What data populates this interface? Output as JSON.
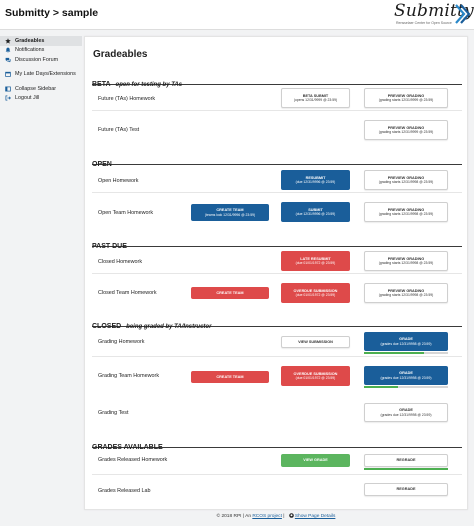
{
  "header": {
    "breadcrumb_course": "Submitty",
    "breadcrumb_sep": " > ",
    "breadcrumb_page": "sample",
    "logo_text": "Submitty",
    "logo_tagline": "Rensselaer Center for Open Source"
  },
  "sidebar": {
    "items": [
      {
        "label": "Gradeables",
        "icon": "star-icon"
      },
      {
        "label": "Notifications",
        "icon": "bell-icon"
      },
      {
        "label": "Discussion Forum",
        "icon": "comments-icon"
      },
      {
        "label": "My Late Days/Extensions",
        "icon": "calendar-icon"
      },
      {
        "label": "Collapse Sidebar",
        "icon": "collapse-icon"
      },
      {
        "label": "Logout Jill",
        "icon": "logout-icon"
      }
    ]
  },
  "main": {
    "title": "Gradeables",
    "sections": [
      {
        "key": "beta",
        "title": "BETA",
        "subtitle": "open for testing by TAs"
      },
      {
        "key": "open",
        "title": "OPEN",
        "subtitle": ""
      },
      {
        "key": "past_due",
        "title": "PAST DUE",
        "subtitle": ""
      },
      {
        "key": "closed",
        "title": "CLOSED",
        "subtitle": "being graded by TA/Instructor"
      },
      {
        "key": "grades_available",
        "title": "GRADES AVAILABLE",
        "subtitle": ""
      }
    ],
    "rows": {
      "future_tas_homework": {
        "name": "Future (TAs) Homework",
        "submit": {
          "l1": "BETA SUBMIT",
          "l2": "(opens 12/31/9999 @ 23:59)"
        },
        "grade": {
          "l1": "PREVIEW GRADING",
          "l2": "(grading starts 12/31/9999 @ 23:59)"
        }
      },
      "future_tas_test": {
        "name": "Future (TAs) Test",
        "grade": {
          "l1": "PREVIEW GRADING",
          "l2": "(grading starts 12/31/9999 @ 23:59)"
        }
      },
      "open_homework": {
        "name": "Open Homework",
        "submit": {
          "l1": "RESUBMIT",
          "l2": "(due 12/31/9996 @ 23:59)"
        },
        "grade": {
          "l1": "PREVIEW GRADING",
          "l2": "(grading starts 12/31/9998 @ 23:59)"
        }
      },
      "open_team_homework": {
        "name": "Open Team Homework",
        "team": {
          "l1": "CREATE TEAM",
          "l2": "(teams lock 12/31/9996 @ 23:59)"
        },
        "submit": {
          "l1": "SUBMIT",
          "l2": "(due 12/31/9996 @ 23:59)"
        },
        "grade": {
          "l1": "PREVIEW GRADING",
          "l2": "(grading starts 12/31/9998 @ 23:59)"
        }
      },
      "closed_homework": {
        "name": "Closed Homework",
        "submit": {
          "l1": "LATE RESUBMIT",
          "l2": "(due 01/01/1972 @ 23:59)"
        },
        "grade": {
          "l1": "PREVIEW GRADING",
          "l2": "(grading starts 12/31/9998 @ 23:59)"
        }
      },
      "closed_team_homework": {
        "name": "Closed Team Homework",
        "team": {
          "l1": "CREATE TEAM"
        },
        "submit": {
          "l1": "OVERDUE SUBMISSION",
          "l2": "(due 01/01/1972 @ 23:59)"
        },
        "grade": {
          "l1": "PREVIEW GRADING",
          "l2": "(grading starts 12/31/9998 @ 23:59)"
        }
      },
      "grading_homework": {
        "name": "Grading Homework",
        "submit": {
          "l1": "VIEW SUBMISSION"
        },
        "grade": {
          "l1": "GRADE",
          "l2": "(grades due 12/31/9998 @ 23:59)"
        },
        "progress": 0.72
      },
      "grading_team_homework": {
        "name": "Grading Team Homework",
        "team": {
          "l1": "CREATE TEAM"
        },
        "submit": {
          "l1": "OVERDUE SUBMISSION",
          "l2": "(due 01/01/1972 @ 23:59)"
        },
        "grade": {
          "l1": "GRADE",
          "l2": "(grades due 12/31/9998 @ 23:59)"
        },
        "progress": 0.4
      },
      "grading_test": {
        "name": "Grading Test",
        "grade": {
          "l1": "GRADE",
          "l2": "(grades due 12/31/9998 @ 23:59)"
        }
      },
      "grades_released_homework": {
        "name": "Grades Released Homework",
        "submit": {
          "l1": "VIEW GRADE"
        },
        "grade": {
          "l1": "REGRADE"
        },
        "progress": 1.0
      },
      "grades_released_lab": {
        "name": "Grades Released Lab",
        "grade": {
          "l1": "REGRADE"
        }
      }
    }
  },
  "footer": {
    "copyright": "© 2018 RPI | An ",
    "rcos_link": "RCOS project",
    "sep": " | ",
    "details_link": "Show Page Details"
  },
  "colors": {
    "blue": "#1a5e9a",
    "red": "#de4a4a",
    "green": "#5cb55f",
    "progress": "#4caf50"
  }
}
